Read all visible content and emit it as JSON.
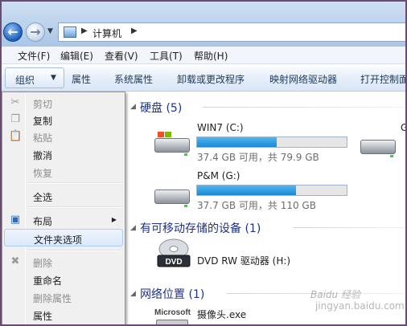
{
  "address": {
    "path": "计算机"
  },
  "menubar": {
    "items": [
      "文件(F)",
      "编辑(E)",
      "查看(V)",
      "工具(T)",
      "帮助(H)"
    ]
  },
  "toolbar": {
    "organize": "组织",
    "items": [
      "属性",
      "系统属性",
      "卸载或更改程序",
      "映射网络驱动器",
      "打开控制面"
    ]
  },
  "groups": {
    "hard_disks": "硬盘 (5)",
    "removable": "有可移动存储的设备 (1)",
    "network": "网络位置 (1)"
  },
  "drives": [
    {
      "name": "WIN7 (C:)",
      "info": "37.4 GB 可用，共 79.9 GB",
      "used_fraction": 0.53
    },
    {
      "name": "P&M (G:)",
      "info": "37.7 GB 可用，共 110 GB",
      "used_fraction": 0.66
    }
  ],
  "drive_partial_letter": "G",
  "dvd": {
    "name": "DVD RW 驱动器 (H:)",
    "logo": "DVD"
  },
  "network_item": {
    "name": "摄像头.exe",
    "brand": "Microsoft"
  },
  "context_menu": {
    "items": [
      {
        "label": "剪切",
        "icon": "scissors-icon",
        "enabled": false
      },
      {
        "label": "复制",
        "icon": "copy-icon",
        "enabled": true
      },
      {
        "label": "粘贴",
        "icon": "paste-icon",
        "enabled": false
      },
      {
        "label": "撤消",
        "icon": "",
        "enabled": true
      },
      {
        "label": "恢复",
        "icon": "",
        "enabled": false
      },
      {
        "label": "全选",
        "icon": "",
        "enabled": true
      },
      {
        "label": "布局",
        "icon": "layout-icon",
        "enabled": true,
        "submenu": true
      },
      {
        "label": "文件夹选项",
        "icon": "",
        "enabled": true,
        "highlighted": true
      },
      {
        "label": "删除",
        "icon": "delete-x-icon",
        "enabled": false
      },
      {
        "label": "重命名",
        "icon": "",
        "enabled": true
      },
      {
        "label": "删除属性",
        "icon": "",
        "enabled": false
      },
      {
        "label": "属性",
        "icon": "",
        "enabled": true
      }
    ]
  },
  "watermark": {
    "line1": "Baidu 经验",
    "line2": "jingyan.baidu.com"
  },
  "colors": {
    "progress": "#1b88d4",
    "group_header": "#1e3287",
    "highlight_border": "#aecbf0"
  }
}
